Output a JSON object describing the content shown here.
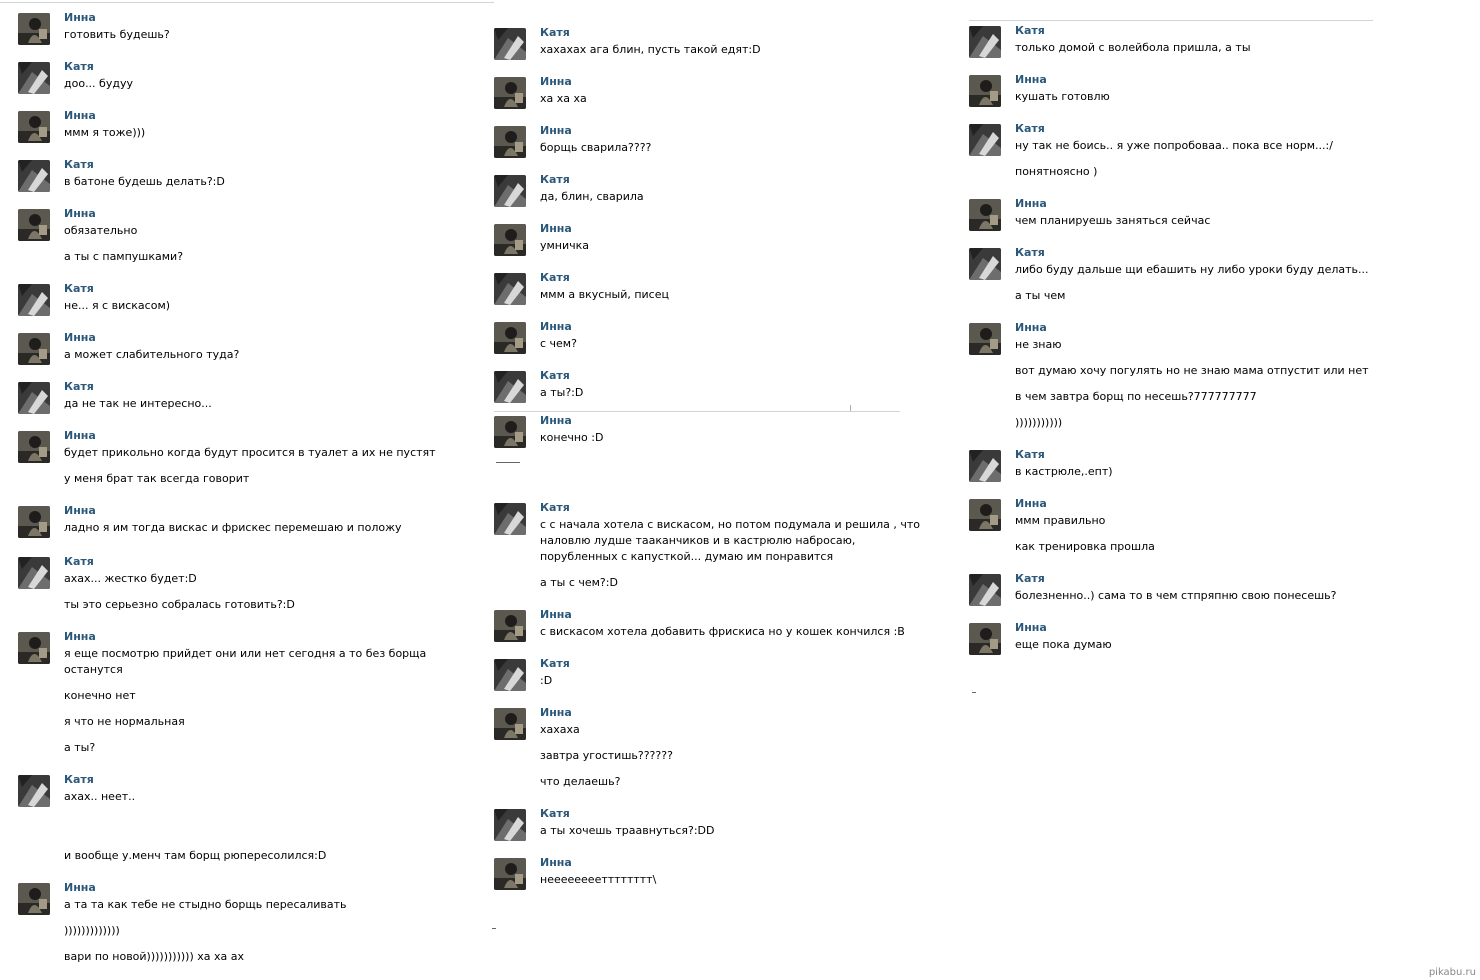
{
  "authors": {
    "inna": "Инна",
    "katya": "Катя"
  },
  "col1": [
    {
      "who": "inna",
      "lines": [
        "готовить будешь?"
      ]
    },
    {
      "who": "katya",
      "lines": [
        "доо... будуу"
      ]
    },
    {
      "who": "inna",
      "lines": [
        "ммм я тоже)))"
      ]
    },
    {
      "who": "katya",
      "lines": [
        "в батоне будешь делать?:D"
      ]
    },
    {
      "who": "inna",
      "lines": [
        "обязательно",
        "а ты с пампушками?"
      ]
    },
    {
      "who": "katya",
      "lines": [
        "не... я с вискасом)"
      ]
    },
    {
      "who": "inna",
      "lines": [
        "а может слабительного туда?"
      ]
    },
    {
      "who": "katya",
      "lines": [
        "да не так не интересно..."
      ]
    },
    {
      "who": "inna",
      "lines": [
        "будет прикольно когда будут просится в туалет а их не пустят",
        "у меня брат так всегда говорит"
      ]
    },
    {
      "who": "inna",
      "lines": [
        "ладно я им тогда вискас и фрискес перемешаю и положу"
      ]
    },
    {
      "who": "katya",
      "lines": [
        "ахах... жестко будет:D",
        "ты это серьезно собралась готовить?:D"
      ]
    },
    {
      "who": "inna",
      "lines": [
        "я еще посмотрю прийдет они или нет сегодня а то без борща",
        "останутся",
        "конечно нет",
        "я что не нормальная",
        "а ты?"
      ]
    },
    {
      "who": "katya",
      "lines": [
        "ахах.. неет..",
        "и вообще у.менч там борщ рюпересолился:D"
      ]
    },
    {
      "who": "inna",
      "lines": [
        "а та та как тебе не стыдно борщь пересаливать",
        ")))))))))))))",
        "вари по новой))))))))))) ха ха ах"
      ]
    }
  ],
  "col2": [
    {
      "who": "katya",
      "lines": [
        "хахахах ага блин, пусть такой едят:D"
      ]
    },
    {
      "who": "inna",
      "lines": [
        "ха ха ха"
      ]
    },
    {
      "who": "inna",
      "lines": [
        "борщь сварила????"
      ]
    },
    {
      "who": "katya",
      "lines": [
        "да, блин, сварила"
      ]
    },
    {
      "who": "inna",
      "lines": [
        "умничка"
      ]
    },
    {
      "who": "katya",
      "lines": [
        "ммм а вкусный, писец"
      ]
    },
    {
      "who": "inna",
      "lines": [
        "с чем?"
      ]
    },
    {
      "who": "katya",
      "lines": [
        "а ты?:D"
      ]
    },
    {
      "who": "inna",
      "lines": [
        "конечно :D"
      ]
    },
    {
      "who": "katya",
      "lines": [
        "с с начала хотела с вискасом, но потом подумала и решила , что",
        "наловлю лудше тааканчиков и в кастрюлю набросаю,",
        "порубленных с капусткой... думаю им понравится",
        "а ты с чем?:D"
      ]
    },
    {
      "who": "inna",
      "lines": [
        "с вискасом хотела добавить фрискиса но у кошек кончился :В"
      ]
    },
    {
      "who": "katya",
      "lines": [
        ":D"
      ]
    },
    {
      "who": "inna",
      "lines": [
        "хахаха",
        "завтра угостишь??????",
        "что делаешь?"
      ]
    },
    {
      "who": "katya",
      "lines": [
        "а ты хочешь траавнуться?:DD"
      ]
    },
    {
      "who": "inna",
      "lines": [
        "неееееееетттттттт\\"
      ]
    }
  ],
  "col3": [
    {
      "who": "katya",
      "lines": [
        "только домой с волейбола пришла, а ты"
      ]
    },
    {
      "who": "inna",
      "lines": [
        "кушать готовлю"
      ]
    },
    {
      "who": "katya",
      "lines": [
        "ну так не боись.. я уже попробоваа.. пока все норм...:/",
        "понятноясно )"
      ]
    },
    {
      "who": "inna",
      "lines": [
        "чем планируешь заняться сейчас"
      ]
    },
    {
      "who": "katya",
      "lines": [
        "либо буду дальше щи ебашить ну либо уроки буду делать...",
        "а ты чем"
      ]
    },
    {
      "who": "inna",
      "lines": [
        "не знаю",
        "вот думаю хочу погулять но не знаю мама отпустит или нет",
        "в чем завтра борщ по несешь?777777777",
        ")))))))))))"
      ]
    },
    {
      "who": "katya",
      "lines": [
        "в кастрюле,.епт)"
      ]
    },
    {
      "who": "inna",
      "lines": [
        "ммм правильно",
        "как тренировка прошла"
      ]
    },
    {
      "who": "katya",
      "lines": [
        "болезненно..) сама то в чем стпряпню свою понесешь?"
      ]
    },
    {
      "who": "inna",
      "lines": [
        "еще пока думаю"
      ]
    }
  ],
  "watermark": "pikabu.ru"
}
